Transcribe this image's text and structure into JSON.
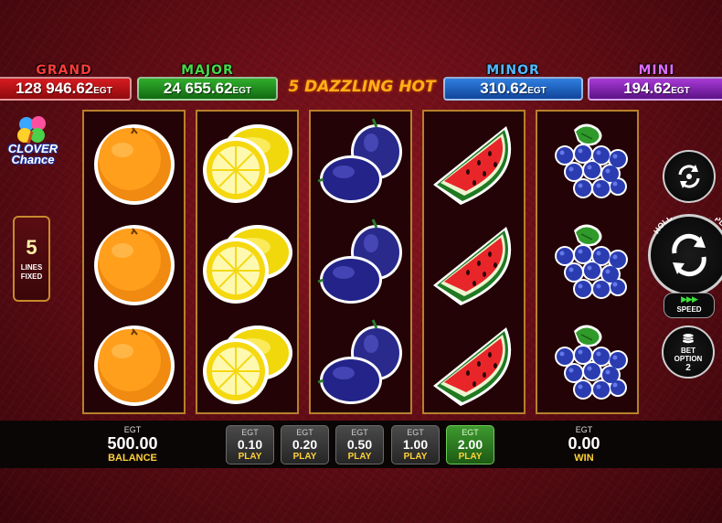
{
  "jackpots": {
    "grand": {
      "title": "GRAND",
      "amount": "128 946.62",
      "currency": "EGT"
    },
    "major": {
      "title": "MAJOR",
      "amount": "24 655.62",
      "currency": "EGT"
    },
    "minor": {
      "title": "MINOR",
      "amount": "310.62",
      "currency": "EGT"
    },
    "mini": {
      "title": "MINI",
      "amount": "194.62",
      "currency": "EGT"
    }
  },
  "game_title": "5 DAZZLING HOT",
  "logo": {
    "line1": "CLOVER",
    "line2": "Chance"
  },
  "lines": {
    "count": "5",
    "label1": "LINES",
    "label2": "FIXED"
  },
  "reels": [
    [
      "orange",
      "orange",
      "orange"
    ],
    [
      "lemon",
      "lemon",
      "lemon"
    ],
    [
      "plum",
      "plum",
      "plum"
    ],
    [
      "watermelon",
      "watermelon",
      "watermelon"
    ],
    [
      "grapes",
      "grapes",
      "grapes"
    ]
  ],
  "controls": {
    "autoplay_icon": "autoplay-icon",
    "spin_hint": "HOLD FOR FAST PLAY",
    "speed_label": "SPEED",
    "speed_arrows": "▶▶▶",
    "bet_option_label1": "BET",
    "bet_option_label2": "OPTION",
    "bet_option_value": "2"
  },
  "bottom": {
    "balance": {
      "currency": "EGT",
      "amount": "500.00",
      "label": "BALANCE"
    },
    "win": {
      "currency": "EGT",
      "amount": "0.00",
      "label": "WIN"
    },
    "bets": [
      {
        "currency": "EGT",
        "amount": "0.10",
        "label": "PLAY",
        "active": false
      },
      {
        "currency": "EGT",
        "amount": "0.20",
        "label": "PLAY",
        "active": false
      },
      {
        "currency": "EGT",
        "amount": "0.50",
        "label": "PLAY",
        "active": false
      },
      {
        "currency": "EGT",
        "amount": "1.00",
        "label": "PLAY",
        "active": false
      },
      {
        "currency": "EGT",
        "amount": "2.00",
        "label": "PLAY",
        "active": true
      }
    ]
  },
  "colors": {
    "grand": "#d71b20",
    "major": "#2fae2b",
    "minor": "#2f7fe0",
    "mini": "#a83ad6",
    "reel_border": "#b8802c",
    "active_bet": "#3d9a2e"
  }
}
